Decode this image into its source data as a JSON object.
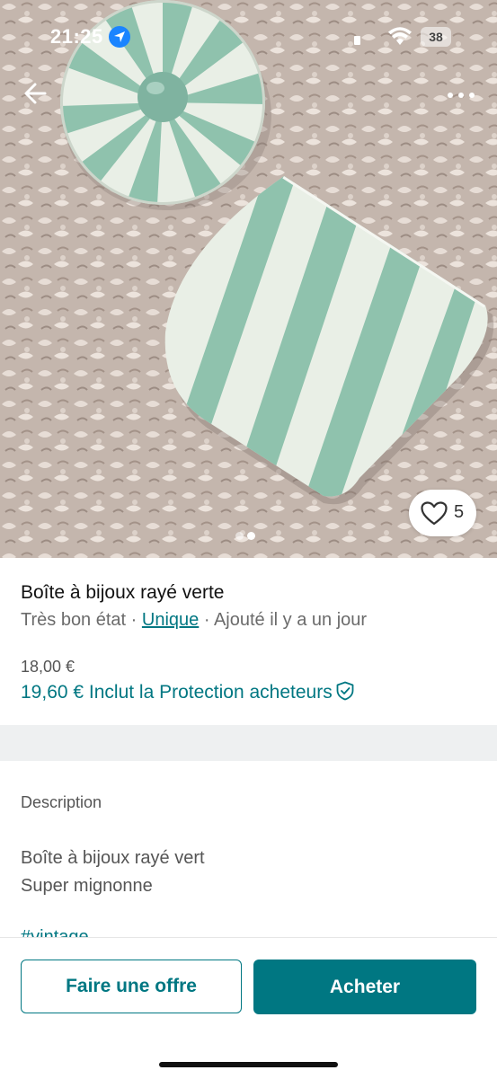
{
  "status_bar": {
    "time": "21:25",
    "battery": "38"
  },
  "photo": {
    "like_count": "5",
    "image_count": 2,
    "active_image": 2
  },
  "item": {
    "title": "Boîte à bijoux rayé verte",
    "condition": "Très bon état",
    "separator": " · ",
    "brand": "Unique",
    "added": "Ajouté il y a un jour",
    "price": "18,00 €",
    "price_with_protection": "19,60 € Inclut la Protection acheteurs"
  },
  "description": {
    "heading": "Description",
    "line1": "Boîte à bijoux rayé vert",
    "line2": "Super mignonne",
    "hashtag_partial": "#vintage"
  },
  "actions": {
    "offer_label": "Faire une offre",
    "buy_label": "Acheter"
  },
  "colors": {
    "accent": "#007782",
    "separator_band": "#eef0f1",
    "ceramic_green": "#8fc2ad",
    "ceramic_white": "#e9efe6"
  },
  "icons": [
    "location-arrow-icon",
    "signal-icon",
    "wifi-icon",
    "battery-icon",
    "back-arrow-icon",
    "more-dots-icon",
    "heart-icon",
    "shield-check-icon"
  ]
}
